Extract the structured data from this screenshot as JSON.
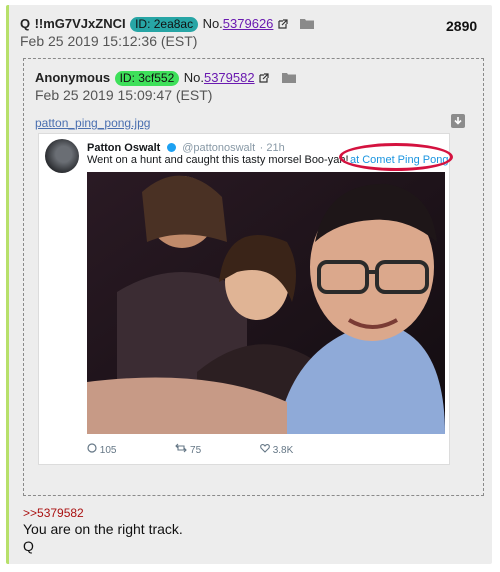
{
  "post": {
    "author": "Q",
    "tripcode": "!!mG7VJxZNCI",
    "id_label": "ID: 2ea8ac",
    "id_color": "#27a5a5",
    "no_prefix": "No.",
    "post_number": "5379626",
    "date": "Feb 25 2019 15:12:36 (EST)",
    "count": "2890",
    "reply_to": ">>5379582",
    "message_line1": "You are on the right track.",
    "message_line2": "Q"
  },
  "quoted": {
    "author": "Anonymous",
    "id_label": "ID: 3cf552",
    "id_color": "#3ee05a",
    "no_prefix": "No.",
    "post_number": "5379582",
    "date": "Feb 25 2019 15:09:47 (EST)",
    "filename": "patton_ping_pong.jpg",
    "tweet": {
      "name": "Patton Oswalt",
      "handle": "@pattonoswalt",
      "age": "· 21h",
      "text": "Went on a hunt and caught this tasty morsel  Boo-yah!",
      "location": "at Comet Ping Pong",
      "replies": "105",
      "retweets": "75",
      "likes": "3.8K"
    }
  },
  "icons": {
    "external_link": "external-link-icon",
    "folder": "folder-icon",
    "download": "download-icon",
    "verified": "verified-badge-icon",
    "reply": "reply-icon",
    "retweet": "retweet-icon",
    "like": "heart-icon"
  }
}
